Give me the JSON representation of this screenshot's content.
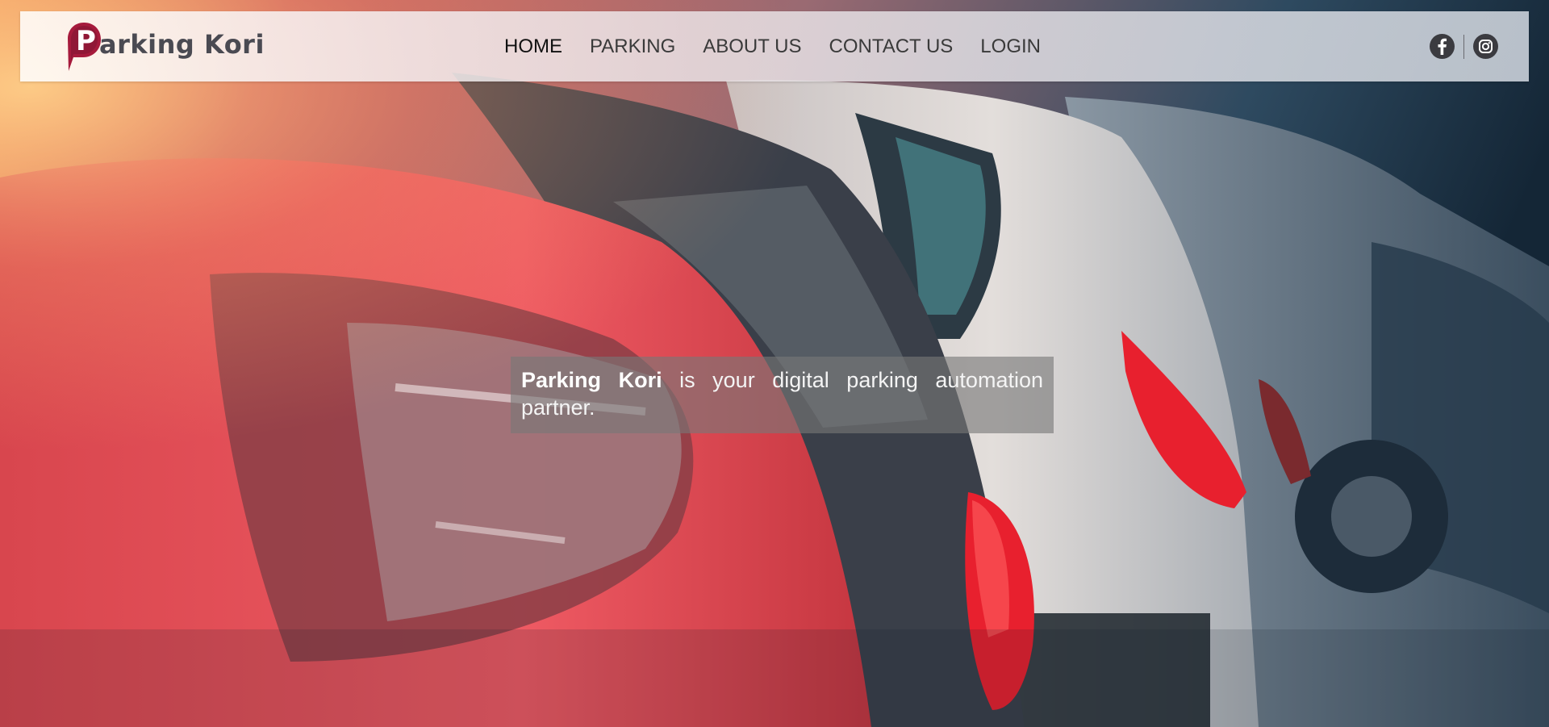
{
  "brand": {
    "name": "Parking Kori",
    "logo_letter": "P",
    "logo_color": "#a61a3c",
    "text_color": "#4a4a52"
  },
  "nav": {
    "items": [
      {
        "label": "HOME",
        "active": true
      },
      {
        "label": "PARKING",
        "active": false
      },
      {
        "label": "ABOUT US",
        "active": false
      },
      {
        "label": "CONTACT US",
        "active": false
      },
      {
        "label": "LOGIN",
        "active": false
      }
    ]
  },
  "social": {
    "icons": [
      "facebook-icon",
      "instagram-icon"
    ]
  },
  "hero": {
    "tagline_brand": "Parking Kori",
    "tagline_rest": " is your digital parking automation partner."
  },
  "colors": {
    "header_bg": "#e8e4e8",
    "tagline_bg": "#787878",
    "car_red": "#e8444e",
    "taillight_red": "#e8202e"
  }
}
